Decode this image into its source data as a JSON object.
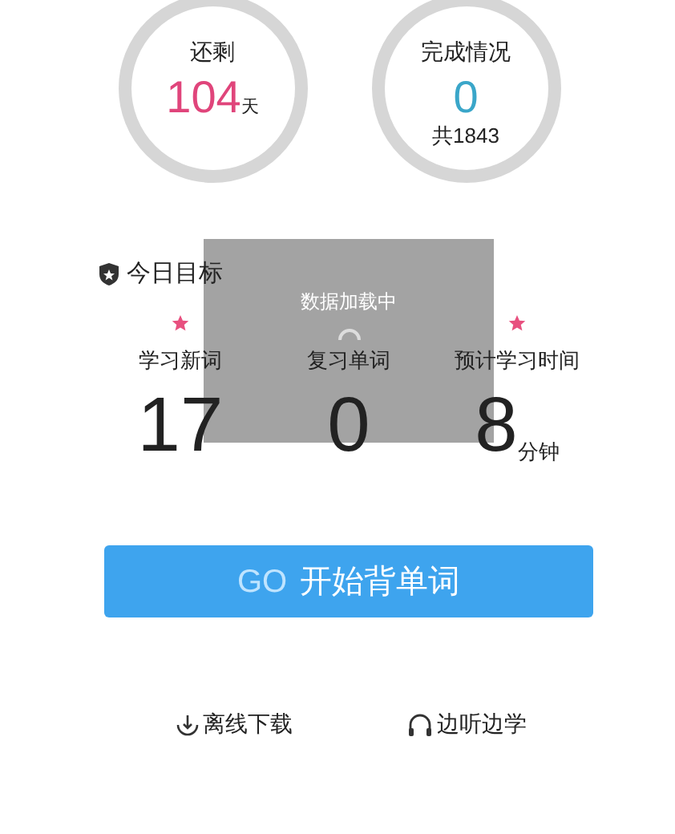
{
  "stats": [
    {
      "kind": "days",
      "title": "还剩",
      "value": "104",
      "unit": "天"
    },
    {
      "kind": "progress",
      "title": "完成情况",
      "value": "0",
      "sub": "共1843"
    }
  ],
  "goal": {
    "title": "今日目标",
    "items": [
      {
        "label": "学习新词",
        "value": "17",
        "starred": true
      },
      {
        "label": "复习单词",
        "value": "0",
        "starred": false
      },
      {
        "label": "预计学习时间",
        "value": "8",
        "unit": "分钟",
        "starred": true
      }
    ]
  },
  "loading": {
    "text": "数据加载中"
  },
  "start_button": {
    "prefix": "GO",
    "label": "开始背单词"
  },
  "links": [
    {
      "kind": "download",
      "label": "离线下载"
    },
    {
      "kind": "listen",
      "label": "边听边学"
    }
  ]
}
